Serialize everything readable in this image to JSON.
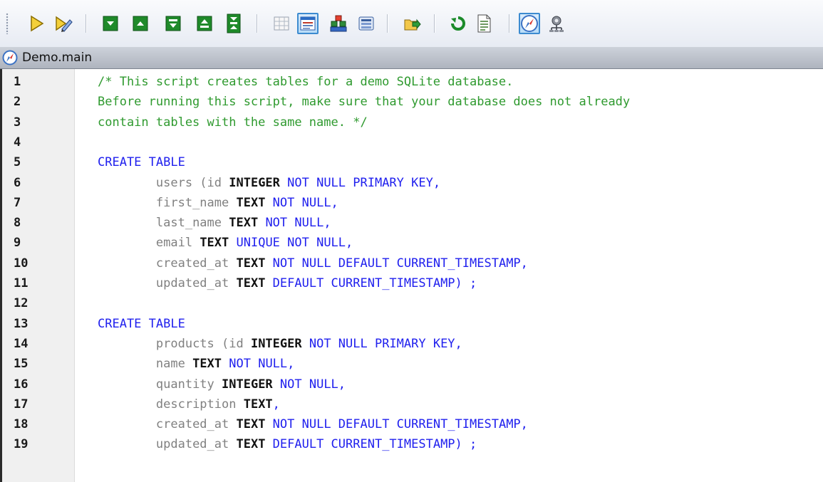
{
  "colors": {
    "toolbar_bg": "#eef1f6",
    "tab_bg": "#bfc4cc",
    "gutter_bg": "#f0f0f0",
    "comment": "#2f9a2f",
    "keyword": "#2020ee",
    "type": "#111111",
    "identifier": "#808080"
  },
  "toolbar": {
    "buttons": [
      {
        "name": "execute-icon",
        "icon": "yellow-play-triangle",
        "pressed": false
      },
      {
        "name": "execute-for-data-editing-icon",
        "icon": "play-with-pencil",
        "pressed": false
      },
      {
        "name": "collapse-icon",
        "icon": "green-box-down",
        "pressed": false
      },
      {
        "name": "expand-icon",
        "icon": "green-box-up",
        "pressed": false
      },
      {
        "name": "collapse-all-icon",
        "icon": "green-box-down-double",
        "pressed": false
      },
      {
        "name": "expand-all-icon",
        "icon": "green-box-up-double",
        "pressed": false
      },
      {
        "name": "toggle-outlining-icon",
        "icon": "green-box-stacked",
        "pressed": false
      },
      {
        "name": "grid-view-icon",
        "icon": "table-grid",
        "pressed": false
      },
      {
        "name": "results-view-icon",
        "icon": "result-window",
        "pressed": true
      },
      {
        "name": "database-objects-icon",
        "icon": "colored-blocks",
        "pressed": false
      },
      {
        "name": "properties-icon",
        "icon": "list-panel",
        "pressed": false
      },
      {
        "name": "export-icon",
        "icon": "folder-arrow",
        "pressed": false
      },
      {
        "name": "refresh-icon",
        "icon": "green-circular-arrow",
        "pressed": false
      },
      {
        "name": "properties-sheet-icon",
        "icon": "document-sheet",
        "pressed": false
      },
      {
        "name": "auto-commit-icon",
        "icon": "compass",
        "pressed": true
      },
      {
        "name": "options-icon",
        "icon": "gear-network",
        "pressed": false
      }
    ]
  },
  "tab": {
    "icon": "compass-icon",
    "label": "Demo.main"
  },
  "editor": {
    "lines": [
      {
        "num": "1",
        "tokens": [
          {
            "t": "/* This script creates tables for a demo SQLite database.",
            "k": "comment"
          }
        ]
      },
      {
        "num": "2",
        "tokens": [
          {
            "t": "Before running this script, make sure that your database does not already",
            "k": "comment"
          }
        ]
      },
      {
        "num": "3",
        "tokens": [
          {
            "t": "contain tables with the same name. */",
            "k": "comment"
          }
        ]
      },
      {
        "num": "4",
        "tokens": []
      },
      {
        "num": "5",
        "tokens": [
          {
            "t": "CREATE TABLE",
            "k": "keyword"
          }
        ]
      },
      {
        "num": "6",
        "tokens": [
          {
            "t": "        ",
            "k": "ident"
          },
          {
            "t": "users (id ",
            "k": "ident"
          },
          {
            "t": "INTEGER",
            "k": "type"
          },
          {
            "t": " NOT NULL PRIMARY KEY,",
            "k": "keyword"
          }
        ]
      },
      {
        "num": "7",
        "tokens": [
          {
            "t": "        ",
            "k": "ident"
          },
          {
            "t": "first_name ",
            "k": "ident"
          },
          {
            "t": "TEXT",
            "k": "type"
          },
          {
            "t": " NOT NULL,",
            "k": "keyword"
          }
        ]
      },
      {
        "num": "8",
        "tokens": [
          {
            "t": "        ",
            "k": "ident"
          },
          {
            "t": "last_name ",
            "k": "ident"
          },
          {
            "t": "TEXT",
            "k": "type"
          },
          {
            "t": " NOT NULL,",
            "k": "keyword"
          }
        ]
      },
      {
        "num": "9",
        "tokens": [
          {
            "t": "        ",
            "k": "ident"
          },
          {
            "t": "email ",
            "k": "ident"
          },
          {
            "t": "TEXT",
            "k": "type"
          },
          {
            "t": " UNIQUE NOT NULL,",
            "k": "keyword"
          }
        ]
      },
      {
        "num": "10",
        "tokens": [
          {
            "t": "        ",
            "k": "ident"
          },
          {
            "t": "created_at ",
            "k": "ident"
          },
          {
            "t": "TEXT",
            "k": "type"
          },
          {
            "t": " NOT NULL DEFAULT CURRENT_TIMESTAMP,",
            "k": "keyword"
          }
        ]
      },
      {
        "num": "11",
        "tokens": [
          {
            "t": "        ",
            "k": "ident"
          },
          {
            "t": "updated_at ",
            "k": "ident"
          },
          {
            "t": "TEXT",
            "k": "type"
          },
          {
            "t": " DEFAULT CURRENT_TIMESTAMP) ;",
            "k": "keyword"
          }
        ]
      },
      {
        "num": "12",
        "tokens": []
      },
      {
        "num": "13",
        "tokens": [
          {
            "t": "CREATE TABLE",
            "k": "keyword"
          }
        ]
      },
      {
        "num": "14",
        "tokens": [
          {
            "t": "        ",
            "k": "ident"
          },
          {
            "t": "products (id ",
            "k": "ident"
          },
          {
            "t": "INTEGER",
            "k": "type"
          },
          {
            "t": " NOT NULL PRIMARY KEY,",
            "k": "keyword"
          }
        ]
      },
      {
        "num": "15",
        "tokens": [
          {
            "t": "        ",
            "k": "ident"
          },
          {
            "t": "name ",
            "k": "ident"
          },
          {
            "t": "TEXT",
            "k": "type"
          },
          {
            "t": " NOT NULL,",
            "k": "keyword"
          }
        ]
      },
      {
        "num": "16",
        "tokens": [
          {
            "t": "        ",
            "k": "ident"
          },
          {
            "t": "quantity ",
            "k": "ident"
          },
          {
            "t": "INTEGER",
            "k": "type"
          },
          {
            "t": " NOT NULL,",
            "k": "keyword"
          }
        ]
      },
      {
        "num": "17",
        "tokens": [
          {
            "t": "        ",
            "k": "ident"
          },
          {
            "t": "description ",
            "k": "ident"
          },
          {
            "t": "TEXT",
            "k": "type"
          },
          {
            "t": ",",
            "k": "keyword"
          }
        ]
      },
      {
        "num": "18",
        "tokens": [
          {
            "t": "        ",
            "k": "ident"
          },
          {
            "t": "created_at ",
            "k": "ident"
          },
          {
            "t": "TEXT",
            "k": "type"
          },
          {
            "t": " NOT NULL DEFAULT CURRENT_TIMESTAMP,",
            "k": "keyword"
          }
        ]
      },
      {
        "num": "19",
        "tokens": [
          {
            "t": "        ",
            "k": "ident"
          },
          {
            "t": "updated_at ",
            "k": "ident"
          },
          {
            "t": "TEXT",
            "k": "type"
          },
          {
            "t": " DEFAULT CURRENT_TIMESTAMP) ;",
            "k": "keyword"
          }
        ]
      }
    ]
  }
}
